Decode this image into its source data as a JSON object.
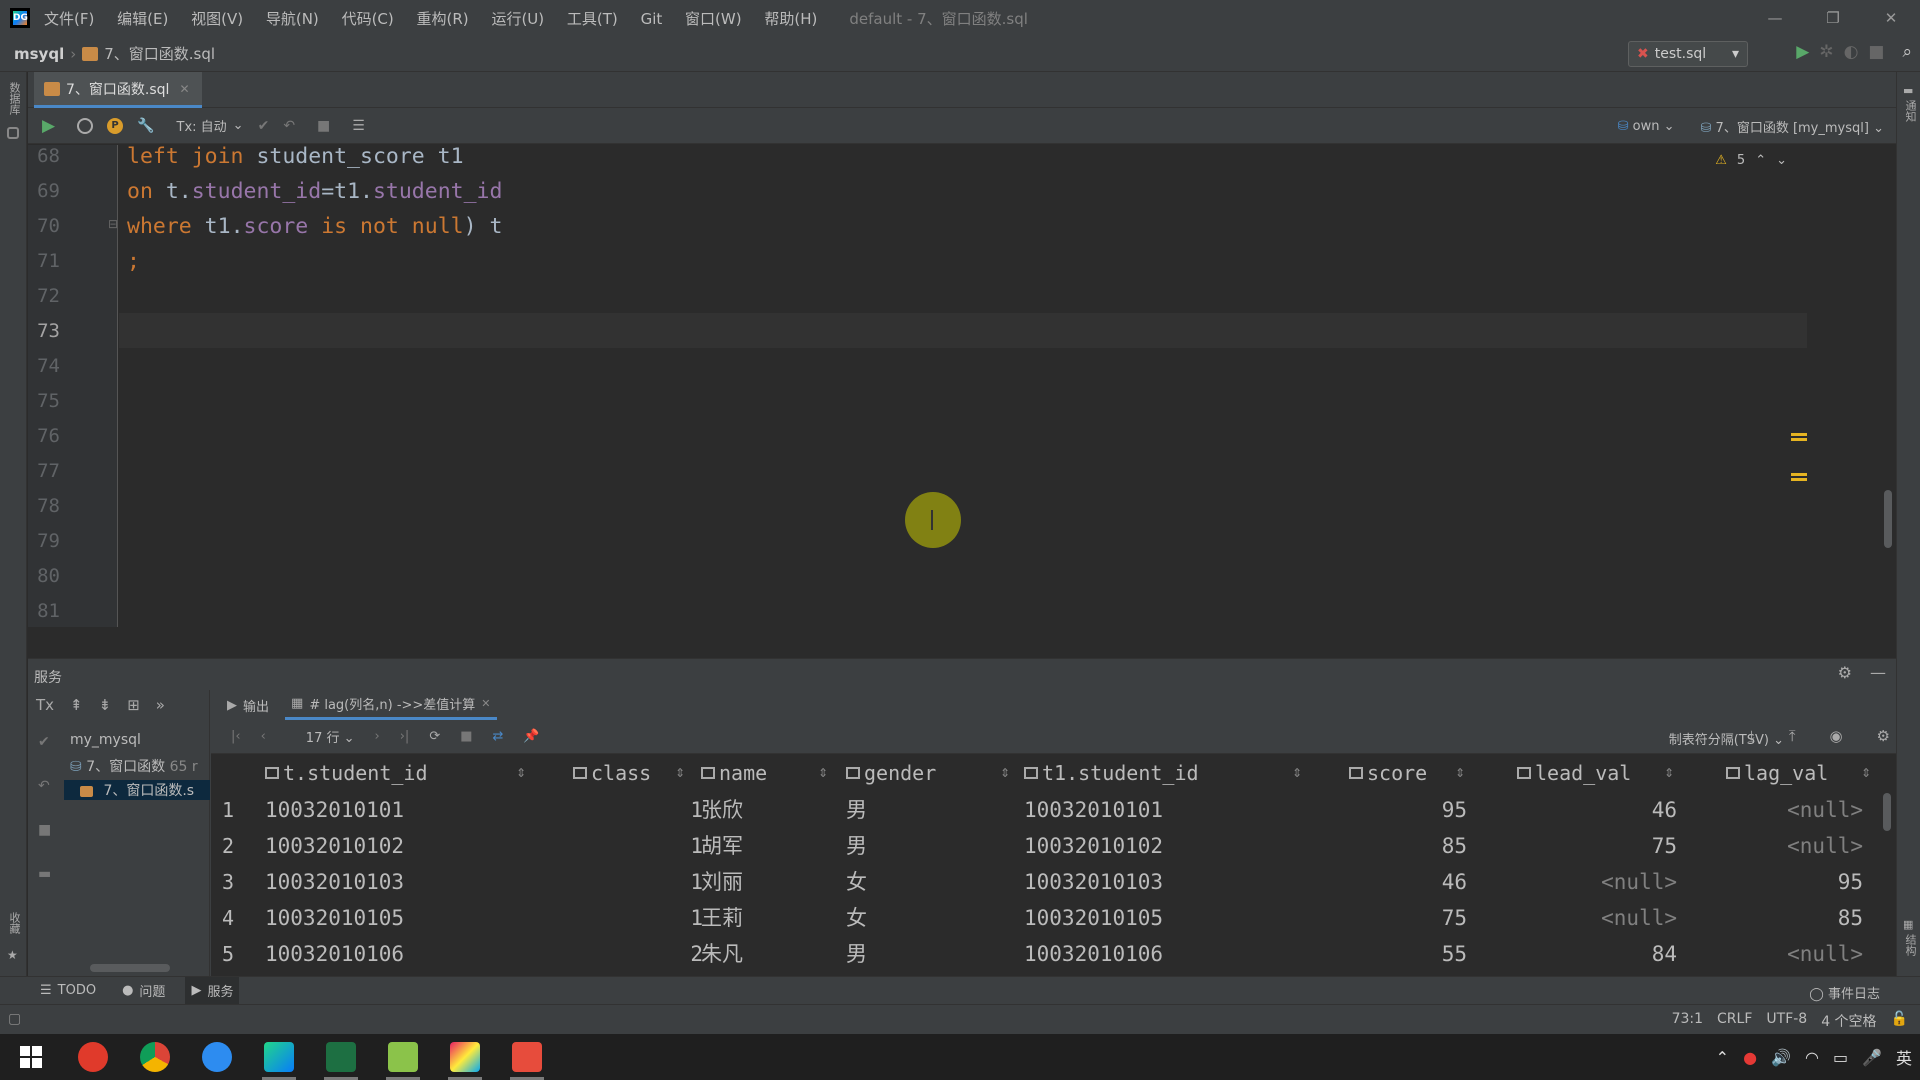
{
  "titlebar": {
    "menus": [
      "文件(F)",
      "编辑(E)",
      "视图(V)",
      "导航(N)",
      "代码(C)",
      "重构(R)",
      "运行(U)",
      "工具(T)",
      "Git",
      "窗口(W)",
      "帮助(H)"
    ],
    "window_title": "default - 7、窗口函数.sql"
  },
  "navbar": {
    "project": "msyql",
    "file": "7、窗口函数.sql",
    "run_config": "test.sql"
  },
  "left_strip": {
    "top_label": "数据库",
    "bottom_label": "收藏"
  },
  "right_strip": {
    "top_label": "通知",
    "bottom_label": "结构"
  },
  "editor_tab": {
    "label": "7、窗口函数.sql"
  },
  "editor_toolbar": {
    "tx_mode": "Tx: 自动",
    "schema": "own",
    "datasource": "7、窗口函数 [my_mysql]"
  },
  "editor": {
    "warning_count": "5",
    "line_numbers": [
      "68",
      "69",
      "70",
      "71",
      "72",
      "73",
      "74",
      "75",
      "76",
      "77",
      "78",
      "79",
      "80",
      "81"
    ],
    "current_line": "73"
  },
  "services": {
    "title": "服务",
    "tree": {
      "root": "my_mysql",
      "child": "7、窗口函数",
      "child_meta": "65 r",
      "leaf": "7、窗口函数.s"
    },
    "tabs": {
      "output": "输出",
      "result": "# lag(列名,n) ->>差值计算"
    },
    "toolbar": {
      "rows": "17 行",
      "format": "制表符分隔(TSV)"
    }
  },
  "result_grid": {
    "columns": [
      "t.student_id",
      "class",
      "name",
      "gender",
      "t1.student_id",
      "score",
      "lead_val",
      "lag_val"
    ],
    "rows": [
      {
        "num": "1",
        "sid": "10032010101",
        "class": "1",
        "name": "张欣",
        "gender": "男",
        "t1sid": "10032010101",
        "score": "95",
        "lead": "46",
        "lag": "<null>"
      },
      {
        "num": "2",
        "sid": "10032010102",
        "class": "1",
        "name": "胡军",
        "gender": "男",
        "t1sid": "10032010102",
        "score": "85",
        "lead": "75",
        "lag": "<null>"
      },
      {
        "num": "3",
        "sid": "10032010103",
        "class": "1",
        "name": "刘丽",
        "gender": "女",
        "t1sid": "10032010103",
        "score": "46",
        "lead": "<null>",
        "lag": "95"
      },
      {
        "num": "4",
        "sid": "10032010105",
        "class": "1",
        "name": "王莉",
        "gender": "女",
        "t1sid": "10032010105",
        "score": "75",
        "lead": "<null>",
        "lag": "85"
      },
      {
        "num": "5",
        "sid": "10032010106",
        "class": "2",
        "name": "朱凡",
        "gender": "男",
        "t1sid": "10032010106",
        "score": "55",
        "lead": "84",
        "lag": "<null>"
      }
    ]
  },
  "bottom_tools": {
    "todo": "TODO",
    "problems": "问题",
    "services": "服务",
    "event_log": "事件日志"
  },
  "statusbar": {
    "position": "73:1",
    "line_sep": "CRLF",
    "encoding": "UTF-8",
    "indent": "4 个空格"
  },
  "taskbar": {
    "ime": "英"
  },
  "colors": {
    "keyword": "#cc7832",
    "field": "#9876aa",
    "accent": "#4a88c7",
    "null": "#808080"
  }
}
